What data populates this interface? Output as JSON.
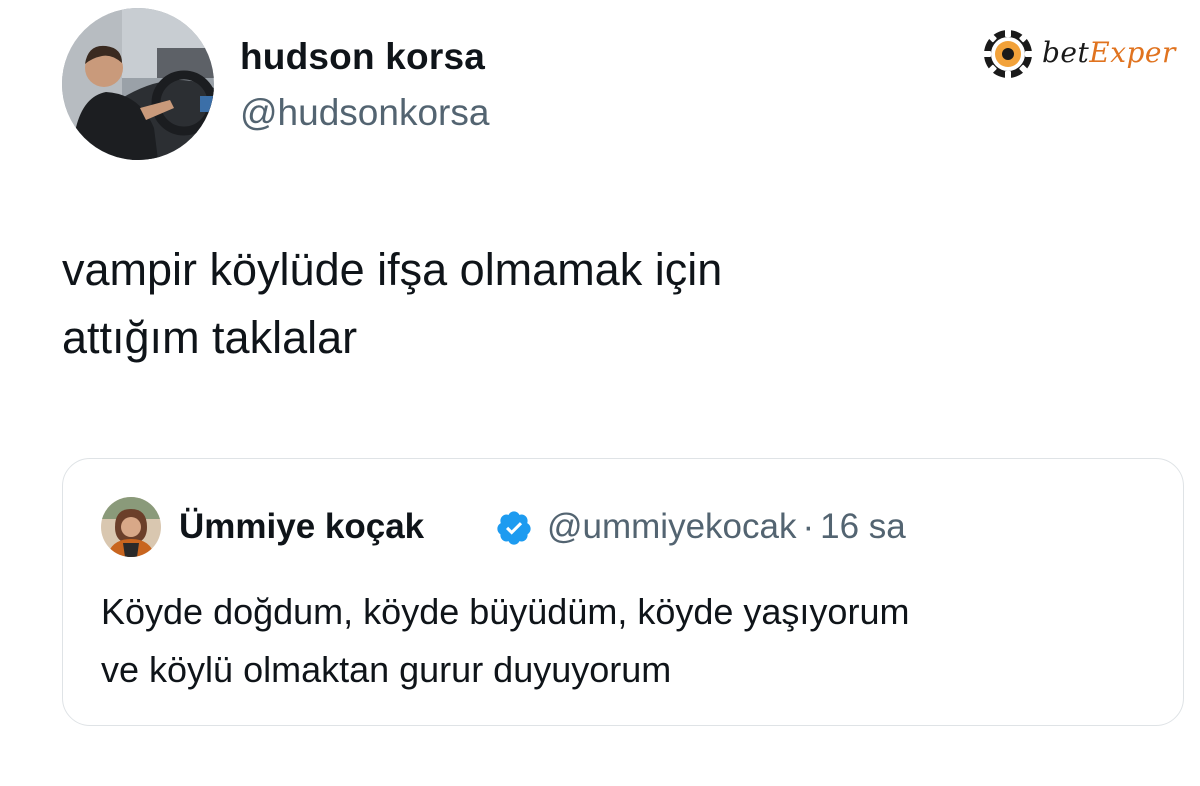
{
  "tweet": {
    "author": {
      "display_name": "hudson korsa",
      "handle": "@hudsonkorsa",
      "avatar_icon": "profile-photo-driving-car"
    },
    "text": "vampir köylüde ifşa olmamak için\nattığım taklalar"
  },
  "quoted_tweet": {
    "author": {
      "display_name": "Ümmiye koçak",
      "handle": "@ummiyekocak",
      "verified": true,
      "avatar_icon": "profile-photo-woman"
    },
    "separator": "·",
    "time": "16 sa",
    "text": "Köyde doğdum, köyde büyüdüm, köyde yaşıyorum\nve köylü olmaktan gurur duyuyorum"
  },
  "watermark": {
    "prefix": "bet",
    "accent": "Exper",
    "accent_color": "#e0731f",
    "icon": "poker-chip-icon"
  },
  "colors": {
    "text_primary": "#0f1419",
    "text_secondary": "#536471",
    "verified_blue": "#1d9bf0",
    "card_border": "#dfe3e6"
  }
}
